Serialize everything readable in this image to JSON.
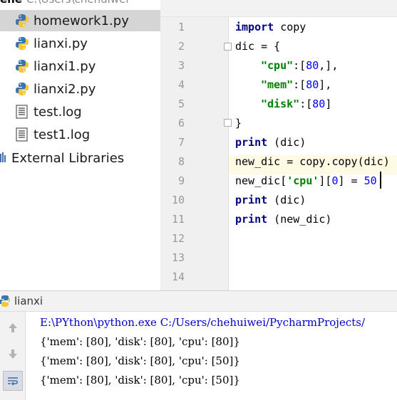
{
  "project": {
    "root_name": "ehe",
    "root_path": "C:\\Users\\chehuiwei",
    "files": [
      {
        "label": "homework1.py",
        "icon": "python-file-icon",
        "selected": true
      },
      {
        "label": "lianxi.py",
        "icon": "python-file-icon",
        "selected": false
      },
      {
        "label": "lianxi1.py",
        "icon": "python-file-icon",
        "selected": false
      },
      {
        "label": "lianxi2.py",
        "icon": "python-file-icon",
        "selected": false
      },
      {
        "label": "test.log",
        "icon": "text-file-icon",
        "selected": false
      },
      {
        "label": "test1.log",
        "icon": "text-file-icon",
        "selected": false
      }
    ],
    "external_libraries": "External Libraries"
  },
  "editor": {
    "line_numbers": [
      "1",
      "2",
      "3",
      "4",
      "5",
      "6",
      "7",
      "8",
      "9",
      "10",
      "11",
      "12",
      "13",
      "14"
    ],
    "current_line": "9",
    "code": {
      "l1_kw": "import",
      "l1_rest": " copy",
      "l2": "dic = {",
      "l3_str": "\"cpu\"",
      "l3_colon": ":[",
      "l3_num": "80",
      "l3_rest": ",],",
      "l4_str": "\"mem\"",
      "l4_colon": ":[",
      "l4_num": "80",
      "l4_rest": "],",
      "l5_str": "\"disk\"",
      "l5_colon": ":[",
      "l5_num": "80",
      "l5_rest": "]",
      "l6": "}",
      "l7_kw": "print",
      "l7_rest": " (dic)",
      "l8": "new_dic = copy.copy(dic)",
      "l9_a": "new_dic[",
      "l9_str": "'cpu'",
      "l9_b": "][",
      "l9_num0": "0",
      "l9_c": "] = ",
      "l9_num": "50",
      "l10_kw": "print",
      "l10_rest": " (dic)",
      "l11_kw": "print",
      "l11_rest": " (new_dic)"
    }
  },
  "run": {
    "tab_label": "lianxi",
    "command": "E:\\PYthon\\python.exe C:/Users/chehuiwei/PycharmProjects/",
    "output": [
      "{'mem': [80], 'disk': [80], 'cpu': [80]}",
      "{'mem': [80], 'disk': [80], 'cpu': [50]}",
      "{'mem': [80], 'disk': [80], 'cpu': [50]}"
    ]
  },
  "colors": {
    "keyword": "#000080",
    "string": "#008000",
    "number": "#0000ff",
    "console_command": "#0000cc",
    "selection": "#d5d5d5",
    "current_line": "#fffae3"
  }
}
